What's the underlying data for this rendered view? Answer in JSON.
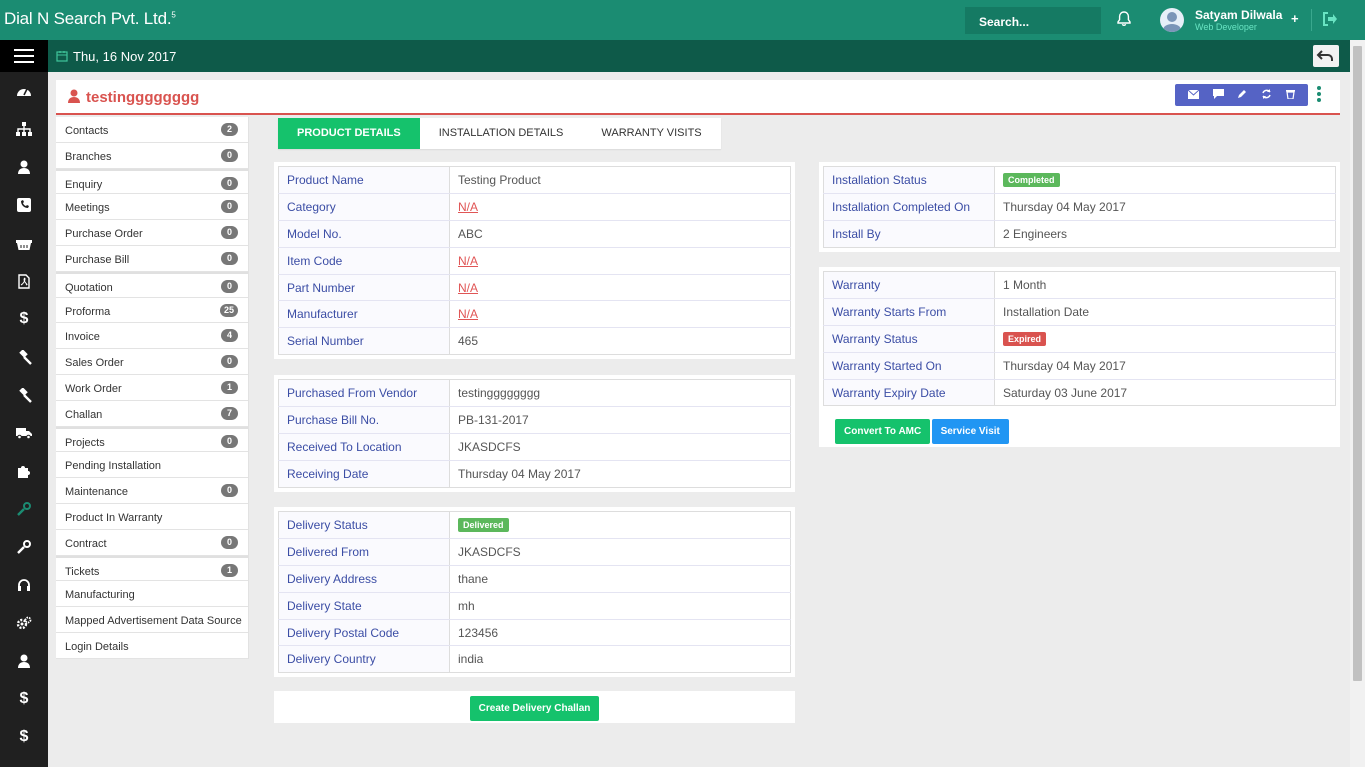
{
  "brand": {
    "name": "Dial N Search Pvt. Ltd.",
    "sup": "5"
  },
  "search": {
    "placeholder": "Search..."
  },
  "user": {
    "name": "Satyam Dilwala",
    "role": "Web Developer"
  },
  "date": "Thu, 16 Nov 2017",
  "record": {
    "title": "testingggggggg"
  },
  "nav": [
    {
      "label": "Contacts",
      "count": "2"
    },
    {
      "label": "Branches",
      "count": "0"
    },
    {
      "label": "Enquiry",
      "count": "0"
    },
    {
      "label": "Meetings",
      "count": "0"
    },
    {
      "label": "Purchase Order",
      "count": "0"
    },
    {
      "label": "Purchase Bill",
      "count": "0"
    },
    {
      "label": "Quotation",
      "count": "0"
    },
    {
      "label": "Proforma",
      "count": "25"
    },
    {
      "label": "Invoice",
      "count": "4"
    },
    {
      "label": "Sales Order",
      "count": "0"
    },
    {
      "label": "Work Order",
      "count": "1"
    },
    {
      "label": "Challan",
      "count": "7"
    },
    {
      "label": "Projects",
      "count": "0"
    },
    {
      "label": "Pending Installation",
      "count": ""
    },
    {
      "label": "Maintenance",
      "count": "0"
    },
    {
      "label": "Product In Warranty",
      "count": ""
    },
    {
      "label": "Contract",
      "count": "0"
    },
    {
      "label": "Tickets",
      "count": "1"
    },
    {
      "label": "Manufacturing",
      "count": ""
    },
    {
      "label": "Mapped Advertisement Data Source",
      "count": ""
    },
    {
      "label": "Login Details",
      "count": ""
    }
  ],
  "tabs": [
    "PRODUCT DETAILS",
    "INSTALLATION DETAILS",
    "WARRANTY VISITS"
  ],
  "product": {
    "name_label": "Product Name",
    "name": "Testing Product",
    "category_label": "Category",
    "category": "N/A",
    "model_label": "Model No.",
    "model": "ABC",
    "item_code_label": "Item Code",
    "item_code": "N/A",
    "part_label": "Part Number",
    "part": "N/A",
    "manufacturer_label": "Manufacturer",
    "manufacturer": "N/A",
    "serial_label": "Serial Number",
    "serial": "465"
  },
  "purchase": {
    "vendor_label": "Purchased From Vendor",
    "vendor": "testingggggggg",
    "bill_label": "Purchase Bill No.",
    "bill": "PB-131-2017",
    "location_label": "Received To Location",
    "location": "JKASDCFS",
    "date_label": "Receiving Date",
    "date": "Thursday 04 May 2017"
  },
  "delivery": {
    "status_label": "Delivery Status",
    "status": "Delivered",
    "from_label": "Delivered From",
    "from": "JKASDCFS",
    "address_label": "Delivery Address",
    "address": "thane",
    "state_label": "Delivery State",
    "state": "mh",
    "postal_label": "Delivery Postal Code",
    "postal": "123456",
    "country_label": "Delivery Country",
    "country": "india",
    "challan_button": "Create Delivery Challan"
  },
  "installation": {
    "status_label": "Installation Status",
    "status": "Completed",
    "completed_label": "Installation Completed On",
    "completed": "Thursday 04 May 2017",
    "by_label": "Install By",
    "by": "2 Engineers"
  },
  "warranty": {
    "warranty_label": "Warranty",
    "warranty": "1 Month",
    "starts_label": "Warranty Starts From",
    "starts": "Installation Date",
    "status_label": "Warranty Status",
    "status": "Expired",
    "started_label": "Warranty Started On",
    "started": "Thursday 04 May 2017",
    "expiry_label": "Warranty Expiry Date",
    "expiry": "Saturday 03 June 2017",
    "amc_button": "Convert To AMC",
    "visit_button": "Service Visit"
  },
  "colors": {
    "topbar": "#1b8c72",
    "subbar": "#0e5a49",
    "accent_red": "#d9534f",
    "tab_active": "#15c26c",
    "label_blue": "#3b4da5",
    "badge_green": "#5cb85c",
    "action_blue": "#5563c5"
  }
}
